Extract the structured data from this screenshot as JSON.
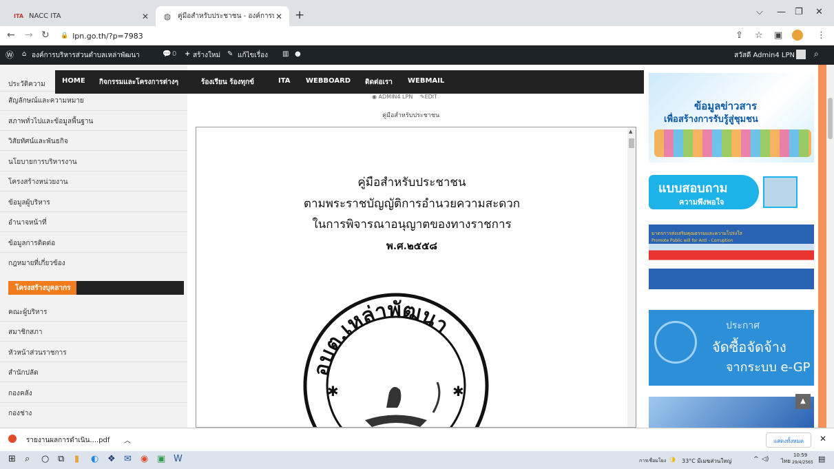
{
  "tabs": [
    {
      "label": "NACC ITA",
      "favicon": "ITA"
    },
    {
      "label": "คู่มือสำหรับประชาชน - องค์การบริหาร"
    }
  ],
  "address": {
    "url": "lpn.go.th/?p=7983"
  },
  "admin_bar": {
    "site": "องค์การบริหารส่วนตำบลเหล่าพัฒนา",
    "comments": "0",
    "new": "สร้างใหม่",
    "edit": "แก้ไขเรื่อง",
    "greeting": "สวัสดี Admin4 LPN"
  },
  "nav": [
    "HOME",
    "กิจกรรมและโครงการต่างๆ",
    "ร้องเรียน ร้องทุกข์",
    "ITA",
    "WEBBOARD",
    "ติดต่อเรา",
    "WEBMAIL"
  ],
  "sidebar": {
    "items": [
      "ประวัติความ",
      "สัญลักษณ์และความหมาย",
      "สภาพทั่วไปและข้อมูลพื้นฐาน",
      "วิสัยทัศน์และพันธกิจ",
      "นโยบายการบริหารงาน",
      "โครงสร้างหน่วยงาน",
      "ข้อมูลผู้บริหาร",
      "อำนาจหน้าที่",
      "ข้อมูลการติดต่อ",
      "กฎหมายที่เกี่ยวข้อง"
    ],
    "section_title": "โครงสร้างบุคลากร",
    "section_items": [
      "คณะผู้บริหาร",
      "สมาชิกสภา",
      "หัวหน้าส่วนราชการ",
      "สำนักปลัด",
      "กองคลัง",
      "กองช่าง"
    ]
  },
  "post": {
    "author": "ADMIN4 LPN",
    "edit": "EDIT",
    "title": "คู่มือสำหรับประชาชน"
  },
  "document": {
    "lines": [
      "คู่มือสำหรับประชาชน",
      "ตามพระราชบัญญัติการอำนวยความสะดวก",
      "ในการพิจารณาอนุญาตของทางราชการ",
      "พ.ศ.๒๕๕๘"
    ],
    "seal_text": "อบต.เหล่าพัฒนา"
  },
  "banners": {
    "news_line1": "ข้อมูลข่าวสาร",
    "news_line2": "เพื่อสร้างการรับรู้สู่ชุมชน",
    "survey_line1": "แบบสอบถาม",
    "survey_line2": "ความพึงพอใจ",
    "integrity_line1": "มาตรการส่งเสริมคุณธรรมและความโปร่งใส",
    "integrity_line2": "Promote Public will for Anti - Corruption",
    "egp_line1": "ประกาศ",
    "egp_line2": "จัดซื้อจัดจ้าง",
    "egp_line3": "จากระบบ e-GP"
  },
  "download": {
    "file": "รายงานผลการดำเนิน....pdf",
    "show_all": "แสดงทั้งหมด"
  },
  "taskbar": {
    "network": "การเชื่อมโยง",
    "weather": "33°C มีเมฆส่วนใหญ่",
    "lang": "ไทย",
    "time": "10:59",
    "date": "29/4/2565"
  },
  "colors": {
    "accent": "#f07c1d",
    "admin_bar": "#1d2327",
    "nav_bg": "#222222",
    "right_bar": "#f39159"
  }
}
